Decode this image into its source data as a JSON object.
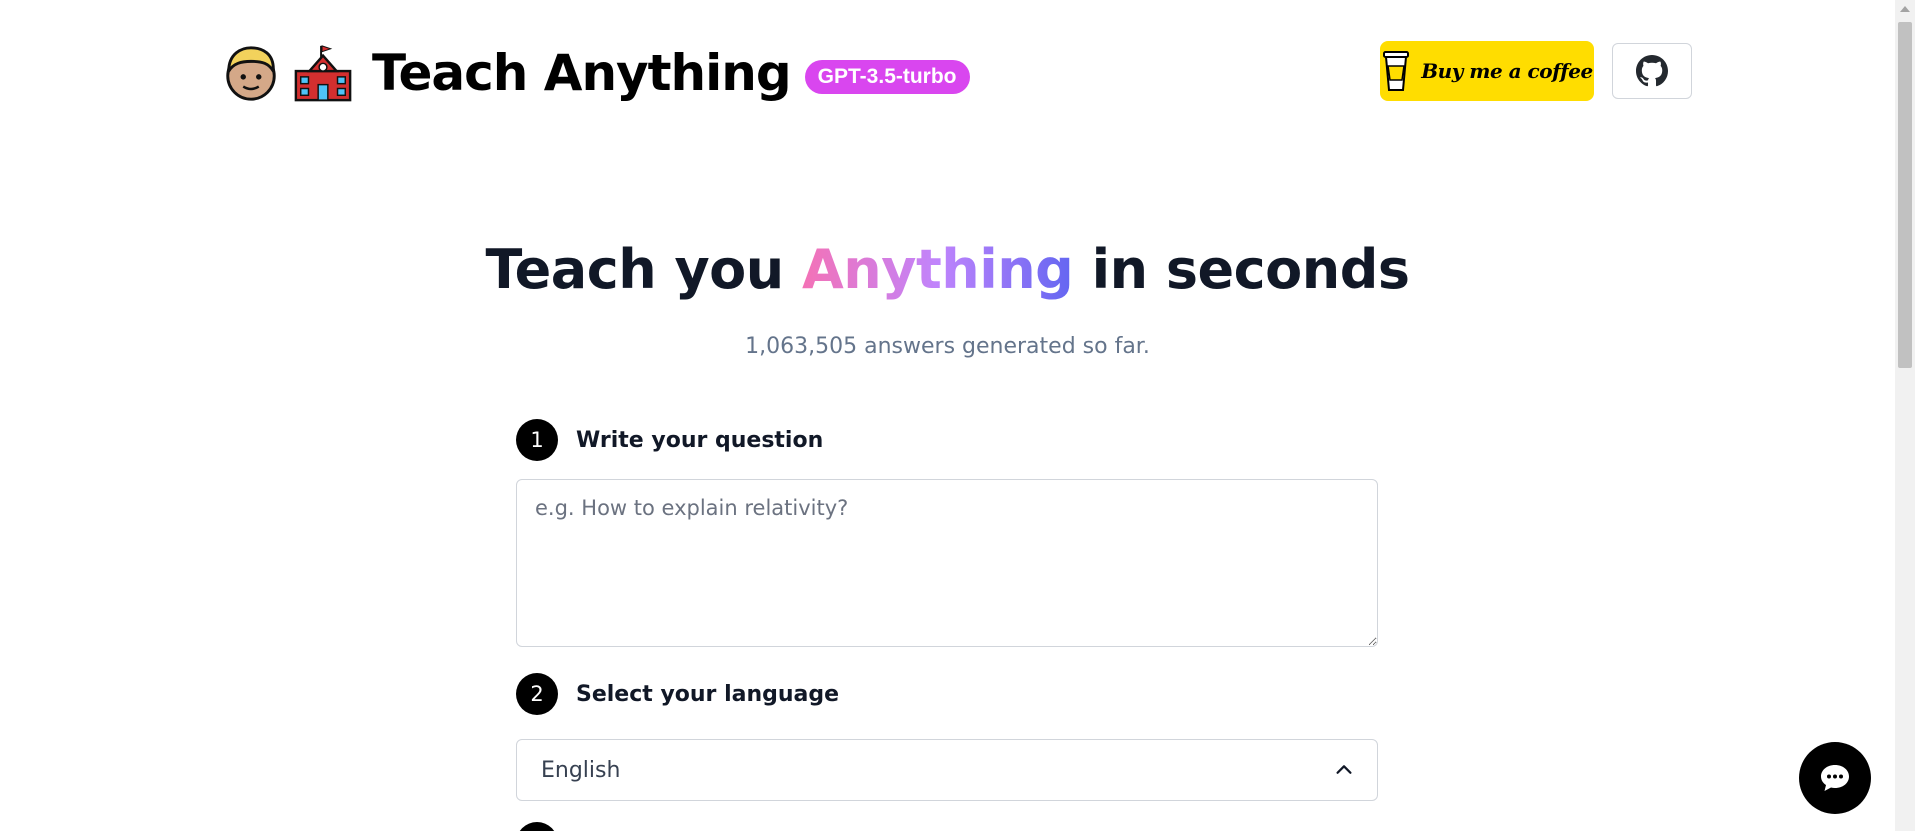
{
  "header": {
    "title": "Teach Anything",
    "model_badge": "GPT-3.5-turbo",
    "emoji_icons": [
      "student-face-icon",
      "school-building-icon"
    ],
    "coffee_button_label": "Buy me a coffee",
    "github_icon": "github-icon"
  },
  "hero": {
    "title_before": "Teach you ",
    "title_highlight": "Anything",
    "title_after": " in seconds",
    "subtitle": "1,063,505 answers generated so far."
  },
  "form": {
    "step1": {
      "number": "1",
      "label": "Write your question",
      "placeholder": "e.g. How to explain relativity?",
      "value": ""
    },
    "step2": {
      "number": "2",
      "label": "Select your language",
      "selected_language": "English"
    }
  },
  "colors": {
    "badge": "#d946ef",
    "coffee_button": "#ffdd00",
    "highlight_start": "#f472b6",
    "highlight_end": "#6366f1",
    "step_circle": "#000000",
    "chat_button": "#000000"
  }
}
